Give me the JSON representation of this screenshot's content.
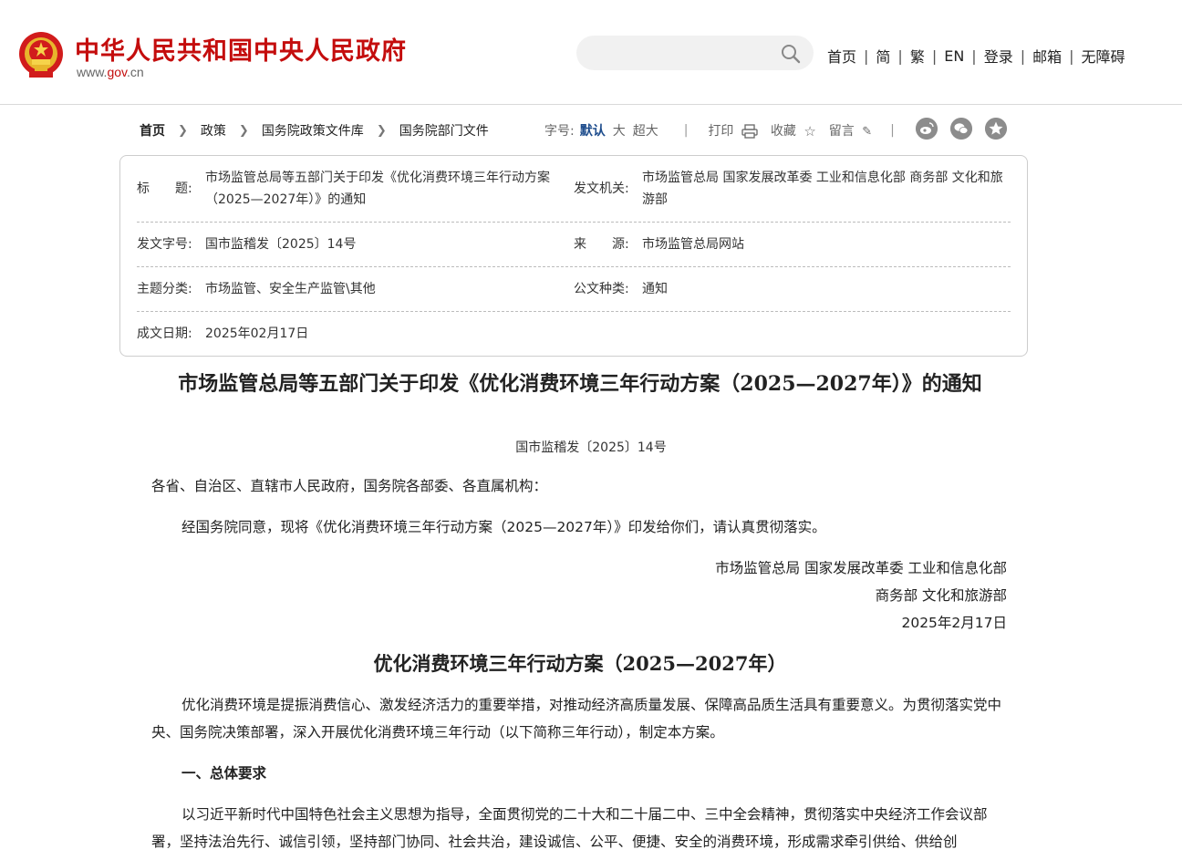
{
  "header": {
    "site_title": "中华人民共和国中央人民政府",
    "site_url_prefix": "www.",
    "site_url_domain": "gov",
    "site_url_suffix": ".cn",
    "search_placeholder": "",
    "nav": [
      "首页",
      "简",
      "繁",
      "EN",
      "登录",
      "邮箱",
      "无障碍"
    ],
    "nav_sep": "|",
    "brand_color": "#c40d0d"
  },
  "breadcrumb": [
    "首页",
    "政策",
    "国务院政策文件库",
    "国务院部门文件"
  ],
  "tools": {
    "font_label": "字号:",
    "font_default": "默认",
    "font_large": "大",
    "font_xlarge": "超大",
    "print": "打印",
    "favorite": "收藏",
    "comment": "留言",
    "share_icons": [
      "weibo-icon",
      "wechat-icon",
      "qzone-icon"
    ]
  },
  "info": {
    "title_label": "标　　题:",
    "title_value": "市场监管总局等五部门关于印发《优化消费环境三年行动方案（2025—2027年）》的通知",
    "issuer_label": "发文机关:",
    "issuer_value": "市场监管总局 国家发展改革委 工业和信息化部 商务部 文化和旅游部",
    "doc_no_label": "发文字号:",
    "doc_no_value": "国市监稽发〔2025〕14号",
    "source_label": "来　　源:",
    "source_value": "市场监管总局网站",
    "topic_label": "主题分类:",
    "topic_value": "市场监管、安全生产监管\\其他",
    "type_label": "公文种类:",
    "type_value": "通知",
    "date_label": "成文日期:",
    "date_value": "2025年02月17日"
  },
  "article": {
    "title": "市场监管总局等五部门关于印发《优化消费环境三年行动方案（2025—2027年）》的通知",
    "doc_no": "国市监稽发〔2025〕14号",
    "salutation": "各省、自治区、直辖市人民政府，国务院各部委、各直属机构：",
    "body1": "经国务院同意，现将《优化消费环境三年行动方案（2025—2027年）》印发给你们，请认真贯彻落实。",
    "sign1": "市场监管总局 国家发展改革委 工业和信息化部",
    "sign2": "商务部 文化和旅游部",
    "sign_date": "2025年2月17日",
    "plan_title": "优化消费环境三年行动方案（2025—2027年）",
    "plan_intro": "优化消费环境是提振消费信心、激发经济活力的重要举措，对推动经济高质量发展、保障高品质生活具有重要意义。为贯彻落实党中央、国务院决策部署，深入开展优化消费环境三年行动（以下简称三年行动），制定本方案。",
    "section1": "一、总体要求",
    "section1_body": "以习近平新时代中国特色社会主义思想为指导，全面贯彻党的二十大和二十届二中、三中全会精神，贯彻落实中央经济工作会议部署，坚持法治先行、诚信引领，坚持部门协同、社会共治，建设诚信、公平、便捷、安全的消费环境，形成需求牵引供给、供给创"
  }
}
